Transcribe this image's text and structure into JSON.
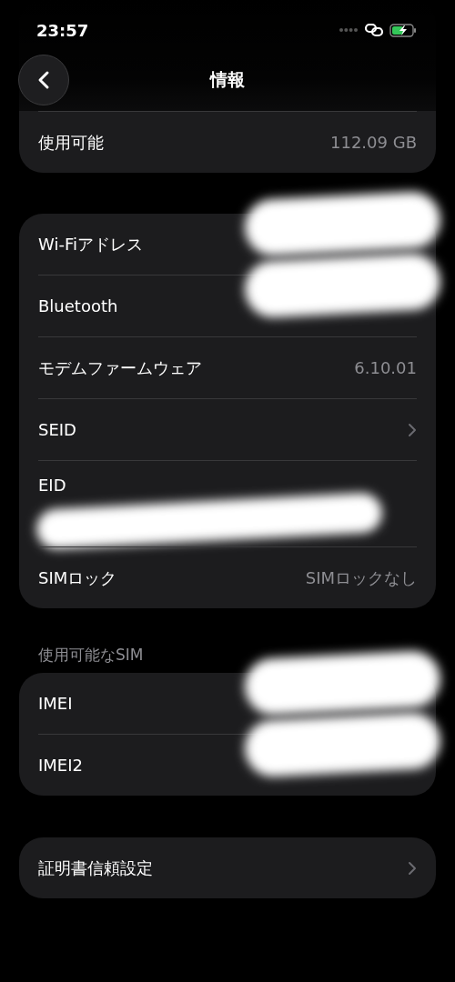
{
  "status_bar": {
    "time": "23:57",
    "battery_charging": true
  },
  "nav": {
    "title": "情報"
  },
  "groups": [
    {
      "rows": [
        {
          "kind": "value",
          "label": "使用可能",
          "value": "112.09 GB"
        }
      ]
    },
    {
      "rows": [
        {
          "kind": "value",
          "label": "Wi-Fiアドレス",
          "redacted": true
        },
        {
          "kind": "value",
          "label": "Bluetooth",
          "redacted": true
        },
        {
          "kind": "value",
          "label": "モデムファームウェア",
          "value": "6.10.01"
        },
        {
          "kind": "value",
          "label": "SEID",
          "chevron": true
        },
        {
          "kind": "stacked",
          "label": "EID",
          "redacted": true
        },
        {
          "kind": "value",
          "label": "SIMロック",
          "value": "SIMロックなし"
        }
      ]
    },
    {
      "header": "使用可能なSIM",
      "rows": [
        {
          "kind": "value",
          "label": "IMEI",
          "redacted": true
        },
        {
          "kind": "value",
          "label": "IMEI2",
          "redacted": true
        }
      ]
    },
    {
      "rows": [
        {
          "kind": "value",
          "label": "証明書信頼設定",
          "chevron": true
        }
      ]
    }
  ]
}
